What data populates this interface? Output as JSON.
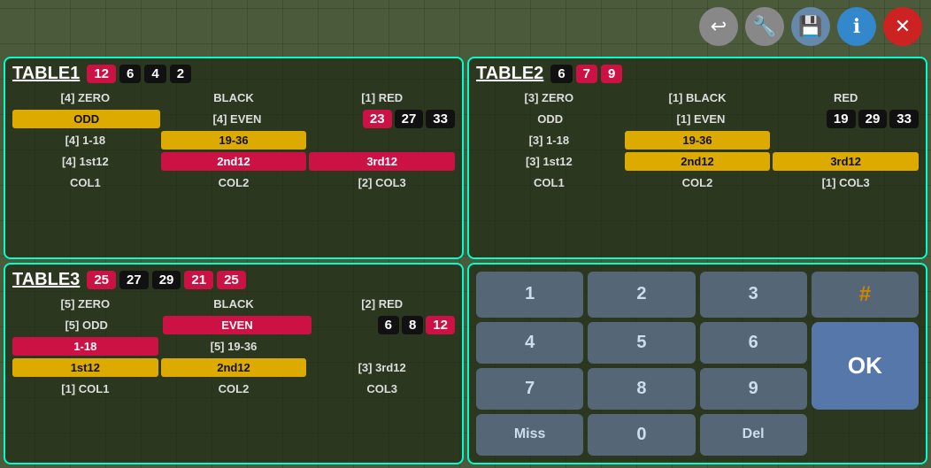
{
  "toolbar": {
    "back_label": "↩",
    "wrench_label": "🔧",
    "save_label": "💾",
    "info_label": "ℹ",
    "close_label": "✕"
  },
  "table1": {
    "title": "TABLE1",
    "badges": [
      {
        "value": "12",
        "type": "red"
      },
      {
        "value": "6",
        "type": "black"
      },
      {
        "value": "4",
        "type": "black"
      },
      {
        "value": "2",
        "type": "black"
      }
    ],
    "rows": [
      {
        "cells": [
          {
            "label": "[4] ZERO",
            "style": "dark"
          },
          {
            "label": "BLACK",
            "style": "dark"
          },
          {
            "label": "[1] RED",
            "style": "dark"
          }
        ]
      },
      {
        "cells": [
          {
            "label": "ODD",
            "style": "yellow"
          },
          {
            "label": "[4] EVEN",
            "style": "dark"
          },
          {
            "label": "",
            "style": "dark"
          }
        ]
      },
      {
        "cells": [
          {
            "label": "",
            "style": "dark"
          },
          {
            "label": "",
            "style": "dark"
          },
          {
            "label": "",
            "style": "dark"
          }
        ]
      },
      {
        "cells": [
          {
            "label": "[4] 1-18",
            "style": "dark"
          },
          {
            "label": "19-36",
            "style": "yellow"
          },
          {
            "label": "",
            "style": "dark"
          }
        ]
      },
      {
        "cells": [
          {
            "label": "[4] 1st12",
            "style": "dark"
          },
          {
            "label": "2nd12",
            "style": "red"
          },
          {
            "label": "3rd12",
            "style": "red"
          }
        ]
      },
      {
        "cells": [
          {
            "label": "COL1",
            "style": "dark"
          },
          {
            "label": "COL2",
            "style": "dark"
          },
          {
            "label": "[2] COL3",
            "style": "dark"
          }
        ]
      }
    ],
    "extra_badges": [
      {
        "value": "23",
        "type": "red"
      },
      {
        "value": "27",
        "type": "black"
      },
      {
        "value": "33",
        "type": "black"
      }
    ]
  },
  "table2": {
    "title": "TABLE2",
    "badges": [
      {
        "value": "6",
        "type": "black"
      },
      {
        "value": "7",
        "type": "red"
      },
      {
        "value": "9",
        "type": "red"
      }
    ],
    "rows": [
      {
        "cells": [
          {
            "label": "[3] ZERO",
            "style": "dark"
          },
          {
            "label": "[1] BLACK",
            "style": "dark"
          },
          {
            "label": "RED",
            "style": "dark"
          }
        ]
      },
      {
        "cells": [
          {
            "label": "ODD",
            "style": "dark"
          },
          {
            "label": "[1] EVEN",
            "style": "dark"
          },
          {
            "label": "",
            "style": "dark"
          }
        ]
      },
      {
        "cells": [
          {
            "label": "",
            "style": "dark"
          },
          {
            "label": "",
            "style": "dark"
          },
          {
            "label": "",
            "style": "dark"
          }
        ]
      },
      {
        "cells": [
          {
            "label": "[3] 1-18",
            "style": "dark"
          },
          {
            "label": "19-36",
            "style": "yellow"
          },
          {
            "label": "",
            "style": "dark"
          }
        ]
      },
      {
        "cells": [
          {
            "label": "[3] 1st12",
            "style": "dark"
          },
          {
            "label": "2nd12",
            "style": "yellow"
          },
          {
            "label": "3rd12",
            "style": "yellow"
          }
        ]
      },
      {
        "cells": [
          {
            "label": "COL1",
            "style": "dark"
          },
          {
            "label": "COL2",
            "style": "dark"
          },
          {
            "label": "[1] COL3",
            "style": "dark"
          }
        ]
      }
    ],
    "extra_badges": [
      {
        "value": "19",
        "type": "black"
      },
      {
        "value": "29",
        "type": "black"
      },
      {
        "value": "33",
        "type": "black"
      }
    ]
  },
  "table3": {
    "title": "TABLE3",
    "badges": [
      {
        "value": "25",
        "type": "red"
      },
      {
        "value": "27",
        "type": "black"
      },
      {
        "value": "29",
        "type": "black"
      },
      {
        "value": "21",
        "type": "red"
      },
      {
        "value": "25",
        "type": "red"
      }
    ],
    "rows": [
      {
        "cells": [
          {
            "label": "[5] ZERO",
            "style": "dark"
          },
          {
            "label": "BLACK",
            "style": "dark"
          },
          {
            "label": "[2] RED",
            "style": "dark"
          }
        ]
      },
      {
        "cells": [
          {
            "label": "[5] ODD",
            "style": "dark"
          },
          {
            "label": "EVEN",
            "style": "red"
          },
          {
            "label": "",
            "style": "dark"
          }
        ]
      },
      {
        "cells": [
          {
            "label": "",
            "style": "dark"
          },
          {
            "label": "",
            "style": "dark"
          },
          {
            "label": "",
            "style": "dark"
          }
        ]
      },
      {
        "cells": [
          {
            "label": "1-18",
            "style": "red"
          },
          {
            "label": "[5] 19-36",
            "style": "dark"
          },
          {
            "label": "",
            "style": "dark"
          }
        ]
      },
      {
        "cells": [
          {
            "label": "1st12",
            "style": "yellow"
          },
          {
            "label": "2nd12",
            "style": "yellow"
          },
          {
            "label": "[3] 3rd12",
            "style": "dark"
          }
        ]
      },
      {
        "cells": [
          {
            "label": "[1] COL1",
            "style": "dark"
          },
          {
            "label": "COL2",
            "style": "dark"
          },
          {
            "label": "COL3",
            "style": "dark"
          }
        ]
      }
    ],
    "extra_badges": [
      {
        "value": "6",
        "type": "black"
      },
      {
        "value": "8",
        "type": "black"
      },
      {
        "value": "12",
        "type": "red"
      }
    ]
  },
  "numpad": {
    "keys": [
      [
        "1",
        "2",
        "3",
        "#"
      ],
      [
        "4",
        "5",
        "6",
        ""
      ],
      [
        "7",
        "8",
        "9",
        ""
      ],
      [
        "Miss",
        "0",
        "Del",
        ""
      ]
    ],
    "ok_label": "OK"
  }
}
